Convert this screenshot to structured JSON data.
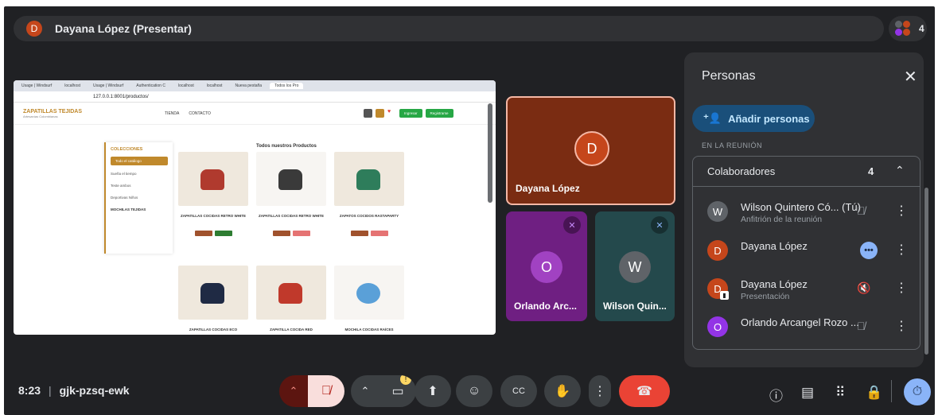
{
  "presenter_bar": {
    "avatar_letter": "D",
    "title": "Dayana López (Presentar)"
  },
  "participants_pill": {
    "count": "4"
  },
  "shared_screen": {
    "tabs": [
      "Usage | Windsurf",
      "localhost",
      "Usage | Windsurf",
      "Authentication C",
      "localhost",
      "localhost",
      "Nueva pestaña",
      "Todos los Pro"
    ],
    "url": "127.0.0.1:8001/productos/",
    "brand": "ZAPATILLAS TEJIDAS",
    "brand_sub": "Artesanías Colombianas",
    "nav_tienda": "TIENDA",
    "nav_contacto": "CONTACTO",
    "btn_ingresar": "Ingresar",
    "btn_registrarse": "Registrarse",
    "collections_title": "COLECCIONES",
    "collections_selected": "Todo el catálogo",
    "collection_items": [
      "Sueña el tiempo",
      "Teste ambos",
      "Deportivas Niños",
      "MOCHILAS TEJIDAS"
    ],
    "products_title": "Todos nuestros Productos",
    "products": [
      "ZAPATILLAS COCIDAS RETRO WHITE",
      "ZAPATILLAS COCIDAS RETRO WHITE",
      "ZAPATOS COCIDOS RASTAPARTY",
      "ZAPATILLAS COCIDAS ECO",
      "ZAPATILLA COCIDA RED",
      "MOCHILA COCIDAS RAÍCES"
    ]
  },
  "tiles": {
    "dayana": {
      "letter": "D",
      "name": "Dayana López"
    },
    "orlando": {
      "letter": "O",
      "name": "Orlando Arc..."
    },
    "wilson": {
      "letter": "W",
      "name": "Wilson Quin..."
    }
  },
  "people_panel": {
    "title": "Personas",
    "add_button": "Añadir personas",
    "section_label": "EN LA REUNIÓN",
    "group_label": "Colaboradores",
    "group_count": "4",
    "people": [
      {
        "letter": "W",
        "name": "Wilson Quintero Có... (Tú)",
        "sub": "Anfitrión de la reunión",
        "color": "#5f6368"
      },
      {
        "letter": "D",
        "name": "Dayana López",
        "sub": "",
        "color": "#c5461b"
      },
      {
        "letter": "D",
        "name": "Dayana López",
        "sub": "Presentación",
        "color": "#c5461b"
      },
      {
        "letter": "O",
        "name": "Orlando Arcangel Rozo ...",
        "sub": "",
        "color": "#9334e6"
      }
    ]
  },
  "bottom_bar": {
    "time": "8:23",
    "meeting_code": "gjk-pzsq-ewk"
  },
  "colors": {
    "hangup": "#ea4335",
    "mic_off": "#f9dedc",
    "accent": "#8ab4f8"
  }
}
